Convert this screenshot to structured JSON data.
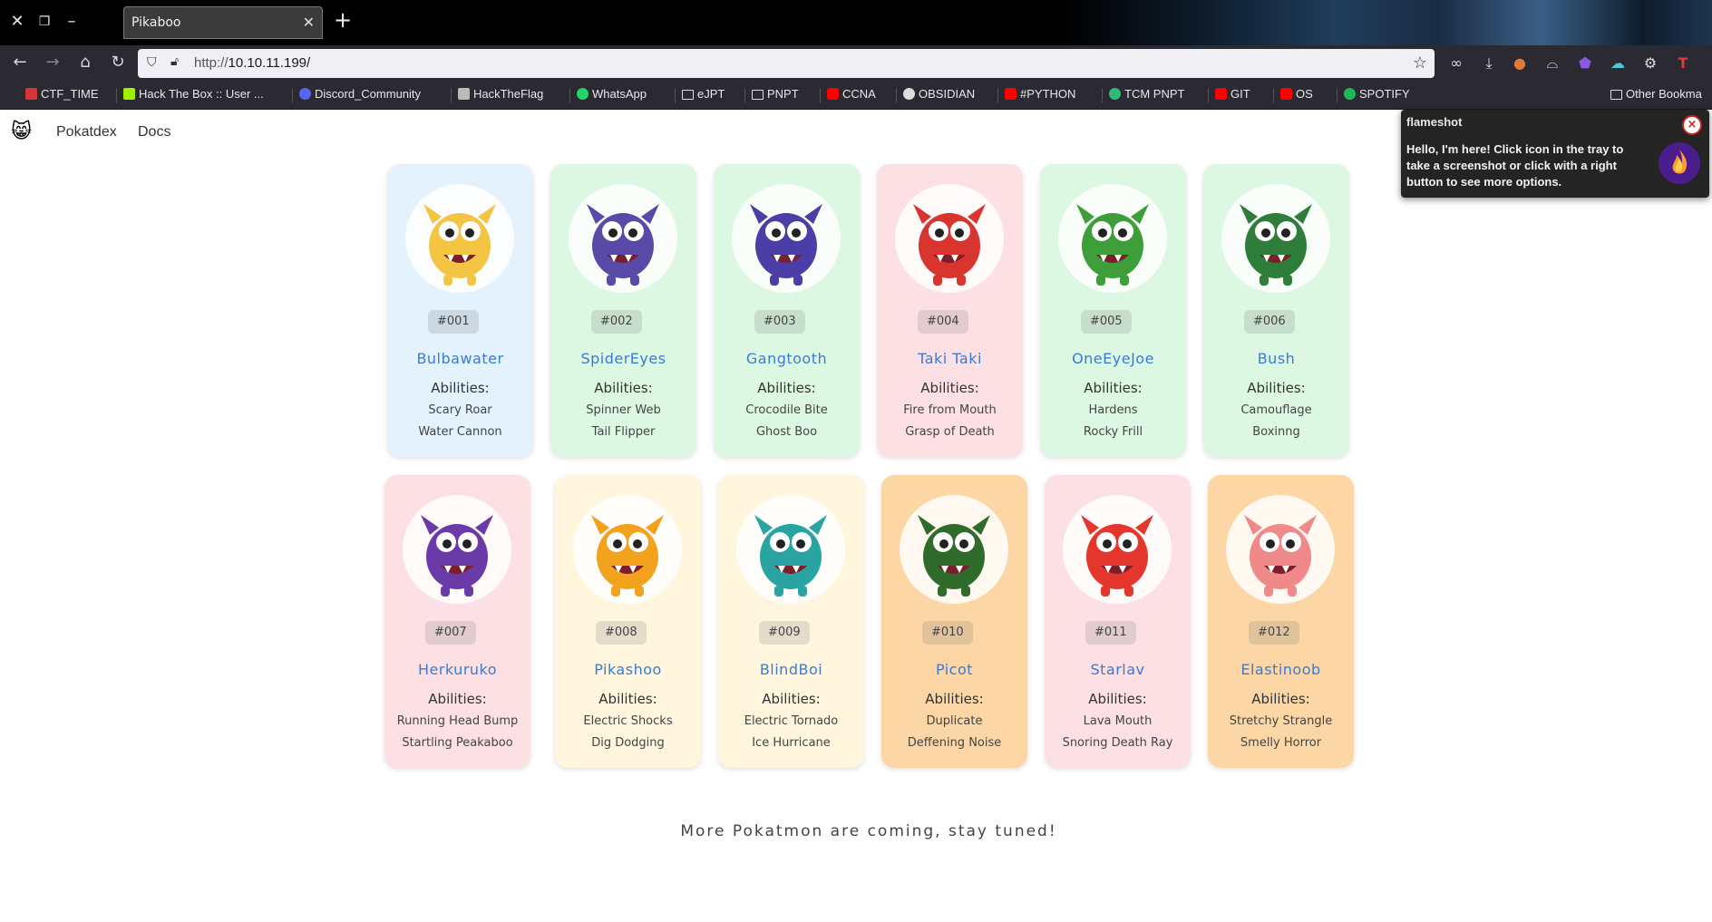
{
  "browser": {
    "tab_title": "Pikaboo",
    "url_prefix": "http://",
    "url_host": "10.10.11.199/",
    "bookmarks": [
      {
        "label": "CTF_TIME",
        "icon": "ctf-icon"
      },
      {
        "label": "Hack The Box :: User ...",
        "icon": "htb-icon"
      },
      {
        "label": "Discord_Community",
        "icon": "discord-icon"
      },
      {
        "label": "HackTheFlag",
        "icon": "flag-icon"
      },
      {
        "label": "WhatsApp",
        "icon": "whatsapp-icon"
      },
      {
        "label": "eJPT",
        "icon": "folder-icon"
      },
      {
        "label": "PNPT",
        "icon": "folder-icon"
      },
      {
        "label": "CCNA",
        "icon": "youtube-icon"
      },
      {
        "label": "OBSIDIAN",
        "icon": "github-icon"
      },
      {
        "label": "#PYTHON",
        "icon": "youtube-icon"
      },
      {
        "label": "TCM PNPT",
        "icon": "tcm-icon"
      },
      {
        "label": "GIT",
        "icon": "youtube-icon"
      },
      {
        "label": "OS",
        "icon": "youtube-icon"
      },
      {
        "label": "SPOTIFY",
        "icon": "spotify-icon"
      }
    ],
    "other_bookmarks": "Other Bookma"
  },
  "site": {
    "nav": {
      "pokatdex": "Pokatdex",
      "docs": "Docs"
    },
    "abilities_label": "Abilities:",
    "footer": "More Pokatmon are coming, stay tuned!"
  },
  "cards": [
    {
      "num": "#001",
      "name": "Bulbawater",
      "a1": "Scary Roar",
      "a2": "Water Cannon",
      "bg": "#e3f2fd",
      "color": "#f4c542"
    },
    {
      "num": "#002",
      "name": "SpiderEyes",
      "a1": "Spinner Web",
      "a2": "Tail Flipper",
      "bg": "#dcf8e2",
      "color": "#5a4aa8"
    },
    {
      "num": "#003",
      "name": "Gangtooth",
      "a1": "Crocodile Bite",
      "a2": "Ghost Boo",
      "bg": "#dcf8e2",
      "color": "#4b3ea6"
    },
    {
      "num": "#004",
      "name": "Taki Taki",
      "a1": "Fire from Mouth",
      "a2": "Grasp of Death",
      "bg": "#fde0e4",
      "color": "#d8352e"
    },
    {
      "num": "#005",
      "name": "OneEyeJoe",
      "a1": "Hardens",
      "a2": "Rocky Frill",
      "bg": "#dcf8e2",
      "color": "#3d9e3a"
    },
    {
      "num": "#006",
      "name": "Bush",
      "a1": "Camouflage",
      "a2": "Boxinng",
      "bg": "#dcf8e2",
      "color": "#2f7d3a"
    },
    {
      "num": "#007",
      "name": "Herkuruko",
      "a1": "Running Head Bump",
      "a2": "Startling Peakaboo",
      "bg": "#fde0e4",
      "color": "#6a3aa8"
    },
    {
      "num": "#008",
      "name": "Pikashoo",
      "a1": "Electric Shocks",
      "a2": "Dig Dodging",
      "bg": "#fff6dd",
      "color": "#f3a21d"
    },
    {
      "num": "#009",
      "name": "BlindBoi",
      "a1": "Electric Tornado",
      "a2": "Ice Hurricane",
      "bg": "#fff6dd",
      "color": "#2aa3a3"
    },
    {
      "num": "#010",
      "name": "Picot",
      "a1": "Duplicate",
      "a2": "Deffening Noise",
      "bg": "#fcd6a4",
      "color": "#2f6b2a"
    },
    {
      "num": "#011",
      "name": "Starlav",
      "a1": "Lava Mouth",
      "a2": "Snoring Death Ray",
      "bg": "#fde0e4",
      "color": "#e5362e"
    },
    {
      "num": "#012",
      "name": "Elastinoob",
      "a1": "Stretchy Strangle",
      "a2": "Smelly Horror",
      "bg": "#fcd6a4",
      "color": "#f08a8a"
    }
  ],
  "flameshot": {
    "title": "flameshot",
    "message": "Hello, I'm here! Click icon in the tray to take a screenshot or click with a right button to see more options."
  }
}
